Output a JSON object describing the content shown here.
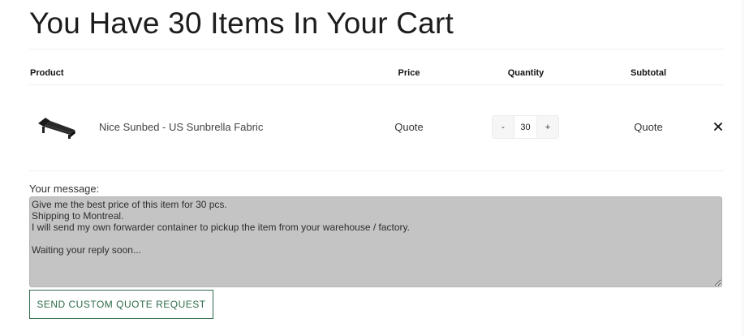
{
  "cart": {
    "title": "You Have 30 Items In Your Cart",
    "columns": {
      "product": "Product",
      "price": "Price",
      "quantity": "Quantity",
      "subtotal": "Subtotal"
    },
    "items": [
      {
        "name": "Nice Sunbed - US Sunbrella Fabric",
        "price": "Quote",
        "quantity": "30",
        "decrement_label": "-",
        "increment_label": "+",
        "subtotal": "Quote",
        "thumbnail_icon": "sunbed-image",
        "remove_icon": "close-icon"
      }
    ]
  },
  "message": {
    "label": "Your message:",
    "value": "Give me the best price of this item for 30 pcs.\nShipping to Montreal.\nI will send my own forwarder container to pickup the item from your warehouse / factory.\n\nWaiting your reply soon..."
  },
  "actions": {
    "send_label": "SEND CUSTOM QUOTE REQUEST"
  },
  "colors": {
    "accent": "#2e6b4b",
    "message_bg": "#c4c4c4"
  }
}
